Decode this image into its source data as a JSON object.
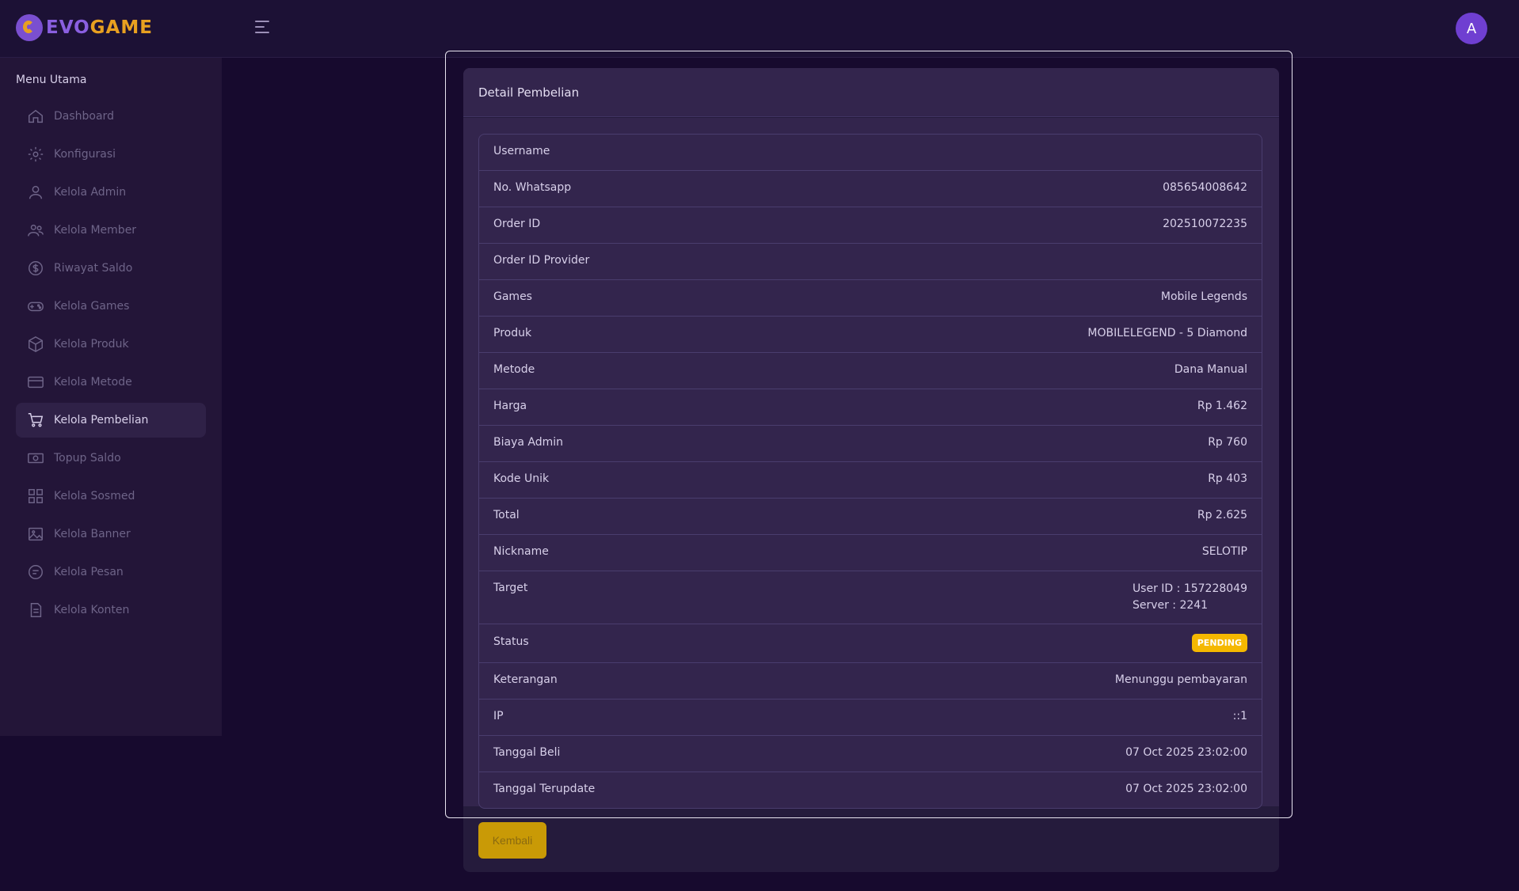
{
  "brand": {
    "name_part1": "EVO",
    "name_part2": "GAME"
  },
  "user": {
    "avatar_initial": "A"
  },
  "sidebar": {
    "title": "Menu Utama",
    "items": [
      {
        "label": "Dashboard",
        "icon": "home-icon"
      },
      {
        "label": "Konfigurasi",
        "icon": "gear-icon"
      },
      {
        "label": "Kelola Admin",
        "icon": "user-icon"
      },
      {
        "label": "Kelola Member",
        "icon": "users-icon"
      },
      {
        "label": "Riwayat Saldo",
        "icon": "dollar-icon"
      },
      {
        "label": "Kelola Games",
        "icon": "gamepad-icon"
      },
      {
        "label": "Kelola Produk",
        "icon": "box-icon"
      },
      {
        "label": "Kelola Metode",
        "icon": "card-icon"
      },
      {
        "label": "Kelola Pembelian",
        "icon": "cart-icon",
        "active": true
      },
      {
        "label": "Topup Saldo",
        "icon": "money-icon"
      },
      {
        "label": "Kelola Sosmed",
        "icon": "grid-icon"
      },
      {
        "label": "Kelola Banner",
        "icon": "image-icon"
      },
      {
        "label": "Kelola Pesan",
        "icon": "chat-icon"
      },
      {
        "label": "Kelola Konten",
        "icon": "document-icon"
      }
    ]
  },
  "detail": {
    "title": "Detail Pembelian",
    "rows": [
      {
        "label": "Username",
        "value": ""
      },
      {
        "label": "No. Whatsapp",
        "value": "085654008642"
      },
      {
        "label": "Order ID",
        "value": "202510072235"
      },
      {
        "label": "Order ID Provider",
        "value": ""
      },
      {
        "label": "Games",
        "value": "Mobile Legends"
      },
      {
        "label": "Produk",
        "value": "MOBILELEGEND - 5 Diamond"
      },
      {
        "label": "Metode",
        "value": "Dana Manual"
      },
      {
        "label": "Harga",
        "value": "Rp 1.462"
      },
      {
        "label": "Biaya Admin",
        "value": "Rp 760"
      },
      {
        "label": "Kode Unik",
        "value": "Rp 403"
      },
      {
        "label": "Total",
        "value": "Rp 2.625"
      },
      {
        "label": "Nickname",
        "value": "SELOTIP"
      }
    ],
    "target": {
      "label": "Target",
      "line1": "User ID : 157228049",
      "line2": "Server : 2241"
    },
    "status": {
      "label": "Status",
      "badge": "PENDING",
      "badge_color": "#f5b800"
    },
    "rows_after": [
      {
        "label": "Keterangan",
        "value": "Menunggu pembayaran"
      },
      {
        "label": "IP",
        "value": "::1"
      },
      {
        "label": "Tanggal Beli",
        "value": "07 Oct 2025 23:02:00"
      },
      {
        "label": "Tanggal Terupdate",
        "value": "07 Oct 2025 23:02:00"
      }
    ],
    "back_label": "Kembali"
  },
  "colors": {
    "accent": "#6f3fd1",
    "brand": "#e8a020",
    "button": "#c99a06"
  }
}
